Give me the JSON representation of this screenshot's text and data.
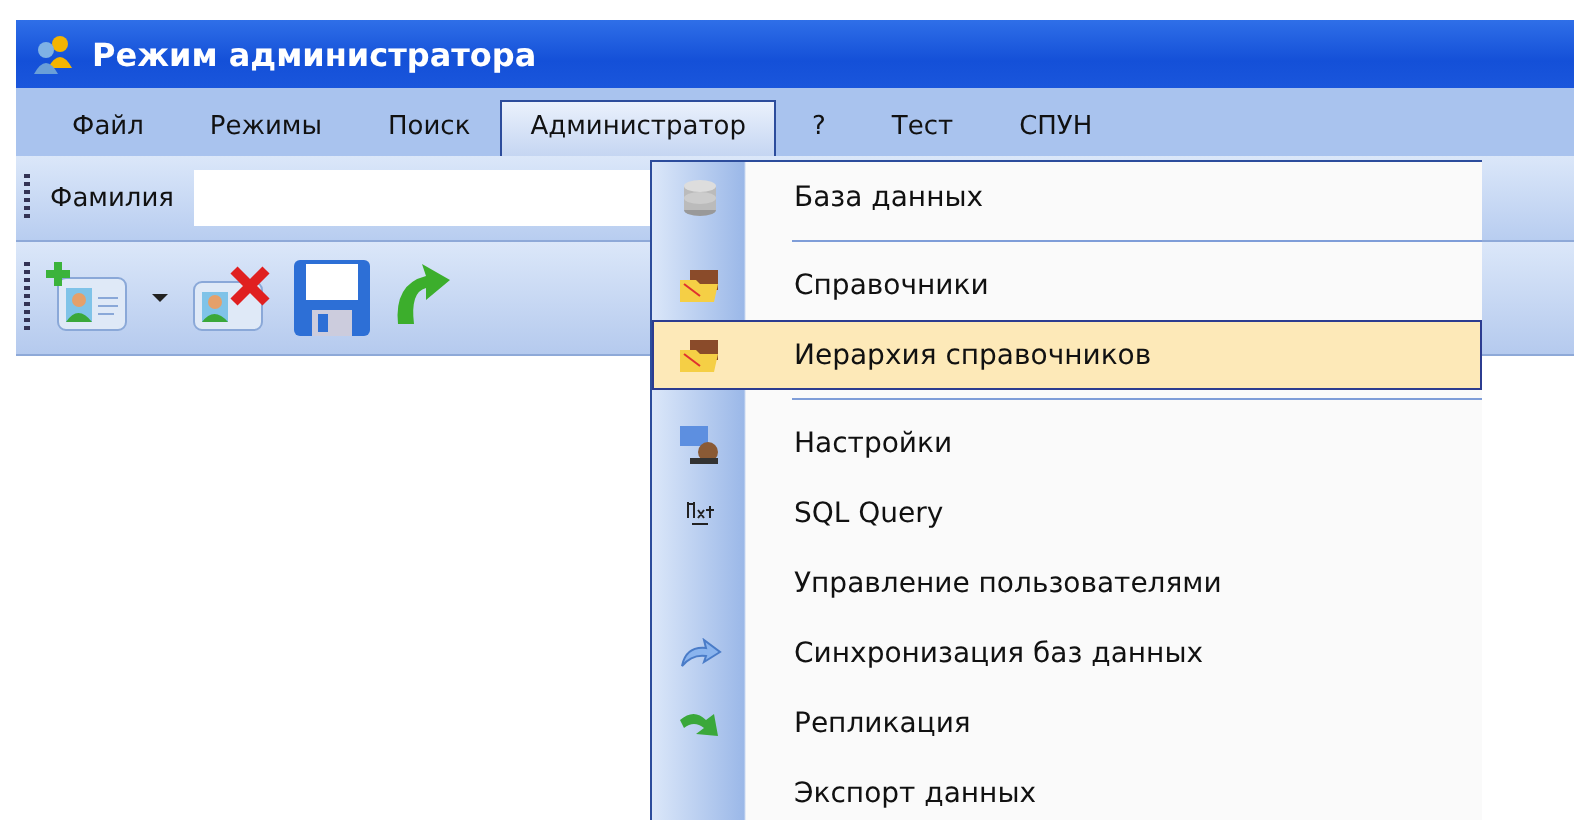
{
  "window": {
    "title": "Режим администратора"
  },
  "menubar": [
    {
      "label": "Файл",
      "selected": false
    },
    {
      "label": "Режимы",
      "selected": false
    },
    {
      "label": "Поиск",
      "selected": false
    },
    {
      "label": "Администратор",
      "selected": true
    },
    {
      "label": "?",
      "selected": false
    },
    {
      "label": "Тест",
      "selected": false
    },
    {
      "label": "СПУН",
      "selected": false
    }
  ],
  "search": {
    "label": "Фамилия"
  },
  "dropdown": [
    {
      "kind": "item",
      "label": "База данных",
      "selected": false
    },
    {
      "kind": "separator"
    },
    {
      "kind": "item",
      "label": "Справочники",
      "selected": false
    },
    {
      "kind": "item",
      "label": "Иерархия справочников",
      "selected": true
    },
    {
      "kind": "separator"
    },
    {
      "kind": "item",
      "label": "Настройки",
      "selected": false
    },
    {
      "kind": "item",
      "label": "SQL Query",
      "selected": false
    },
    {
      "kind": "item",
      "label": "Управление пользователями",
      "selected": false
    },
    {
      "kind": "item",
      "label": "Синхронизация баз данных",
      "selected": false
    },
    {
      "kind": "item",
      "label": "Репликация",
      "selected": false
    },
    {
      "kind": "item",
      "label": "Экспорт данных",
      "selected": false
    }
  ]
}
